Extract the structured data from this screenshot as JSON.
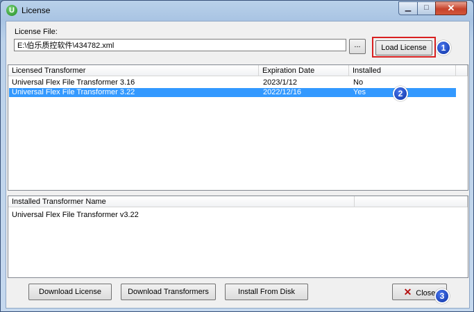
{
  "window": {
    "title": "License",
    "app_icon_letter": "U",
    "min_glyph": "▁",
    "max_glyph": "□",
    "close_glyph": "✕"
  },
  "license_file": {
    "label": "License File:",
    "value": "E:\\伯乐质控软件\\434782.xml",
    "browse_label": "..."
  },
  "load_button": {
    "label": "Load License"
  },
  "markers": [
    "1",
    "2",
    "3"
  ],
  "licensed_table": {
    "columns": [
      "Licensed Transformer",
      "Expiration Date",
      "Installed"
    ],
    "rows": [
      {
        "name": "Universal Flex File Transformer 3.16",
        "expiration": "2023/1/12",
        "installed": "No",
        "selected": false
      },
      {
        "name": "Universal Flex File Transformer 3.22",
        "expiration": "2022/12/16",
        "installed": "Yes",
        "selected": true
      }
    ]
  },
  "installed_table": {
    "columns": [
      "Installed Transformer Name"
    ],
    "rows": [
      "Universal Flex File Transformer v3.22"
    ]
  },
  "buttons": {
    "download_license": "Download License",
    "download_transformers": "Download Transformers",
    "install_from_disk": "Install From Disk",
    "close": "Close",
    "close_icon": "✕"
  },
  "colors": {
    "selection": "#3399ff",
    "highlight_box": "#d81f1f",
    "marker": "#1440c0"
  }
}
